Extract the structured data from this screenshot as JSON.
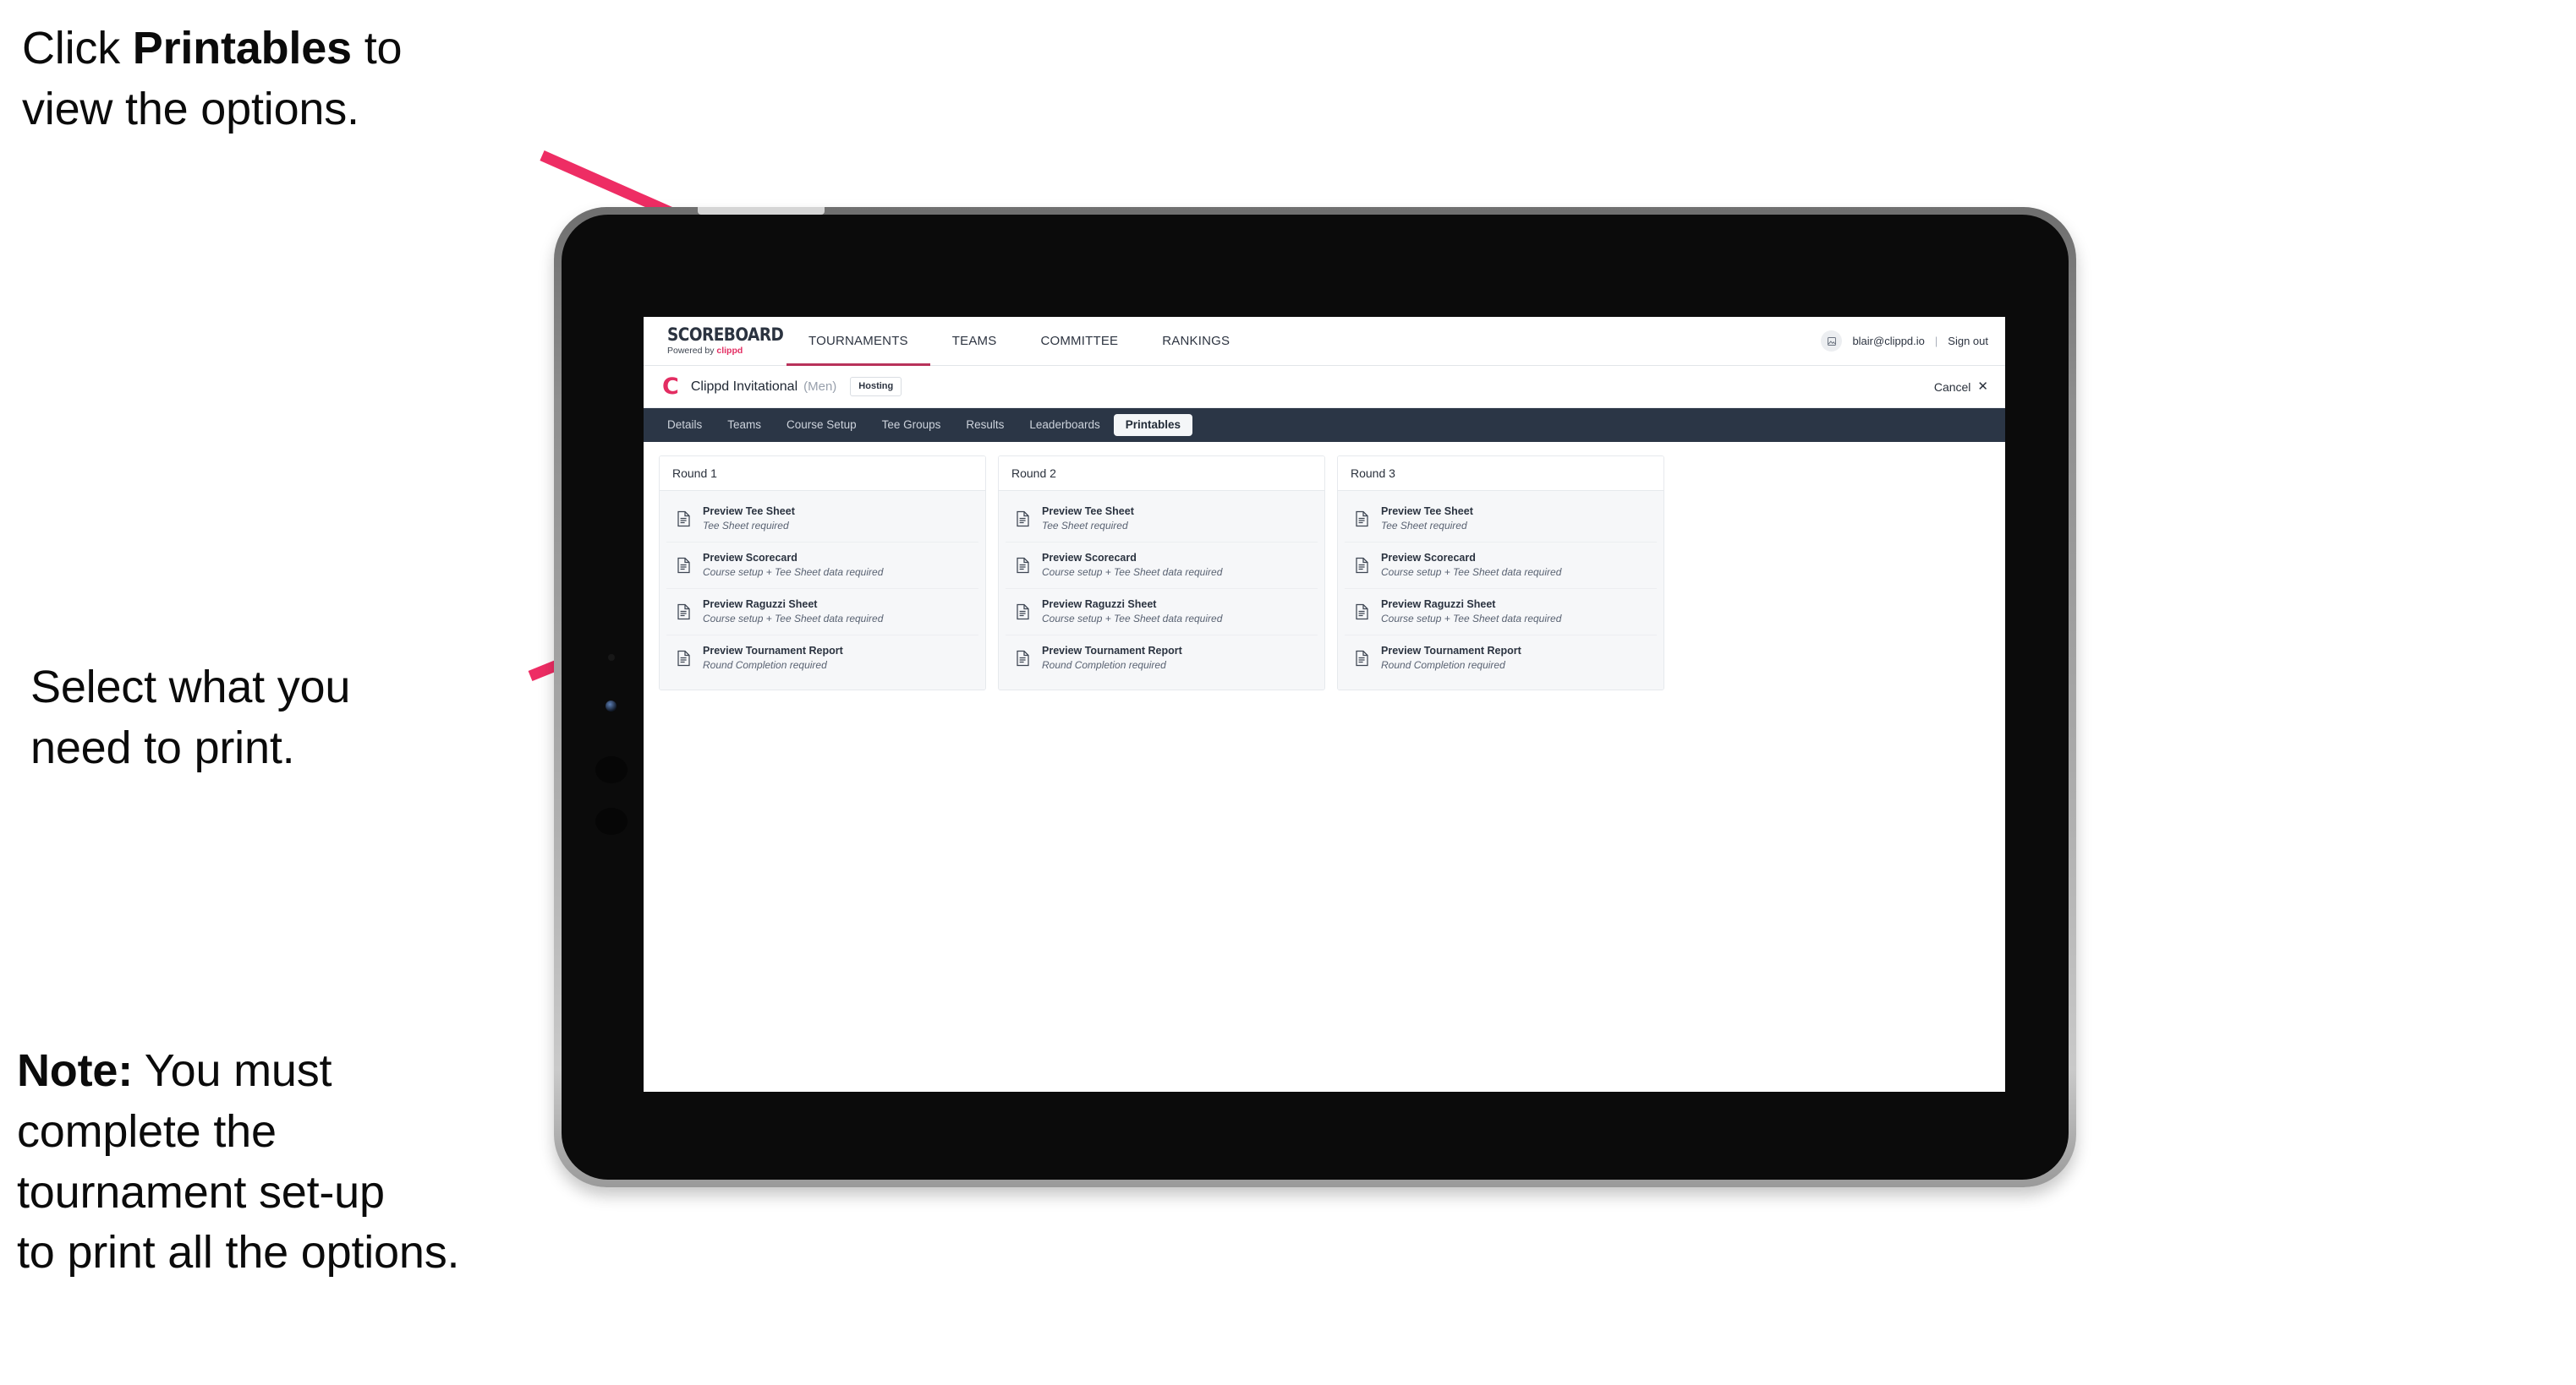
{
  "annotations": {
    "callout_1": {
      "prefix": "Click ",
      "bold": "Printables",
      "suffix": " to\nview the options."
    },
    "callout_2": {
      "text": "Select what you\n need to print."
    },
    "callout_3": {
      "bold": "Note:",
      "text": " You must\ncomplete the\ntournament set-up\nto print all the options."
    },
    "arrow_color": "#ee2d64"
  },
  "app": {
    "brand": {
      "title": "SCOREBOARD",
      "powered_by": "Powered by ",
      "clippd": "clippd"
    },
    "main_nav": [
      {
        "label": "TOURNAMENTS",
        "active": true
      },
      {
        "label": "TEAMS",
        "active": false
      },
      {
        "label": "COMMITTEE",
        "active": false
      },
      {
        "label": "RANKINGS",
        "active": false
      }
    ],
    "account": {
      "avatar_icon": "user-avatar-icon",
      "email": "blair@clippd.io",
      "separator": "|",
      "sign_out": "Sign out"
    },
    "tournament_header": {
      "logo_letter": "C",
      "name": "Clippd Invitational",
      "gender": "(Men)",
      "status_badge": "Hosting",
      "cancel_label": "Cancel",
      "cancel_icon": "close-icon"
    },
    "tabs": [
      {
        "label": "Details",
        "active": false
      },
      {
        "label": "Teams",
        "active": false
      },
      {
        "label": "Course Setup",
        "active": false
      },
      {
        "label": "Tee Groups",
        "active": false
      },
      {
        "label": "Results",
        "active": false
      },
      {
        "label": "Leaderboards",
        "active": false
      },
      {
        "label": "Printables",
        "active": true
      }
    ],
    "rounds": [
      {
        "title": "Round 1",
        "items": [
          {
            "title": "Preview Tee Sheet",
            "subtitle": "Tee Sheet required",
            "icon": "document-icon"
          },
          {
            "title": "Preview Scorecard",
            "subtitle": "Course setup + Tee Sheet data required",
            "icon": "document-icon"
          },
          {
            "title": "Preview Raguzzi Sheet",
            "subtitle": "Course setup + Tee Sheet data required",
            "icon": "document-icon"
          },
          {
            "title": "Preview Tournament Report",
            "subtitle": "Round Completion required",
            "icon": "document-icon"
          }
        ]
      },
      {
        "title": "Round 2",
        "items": [
          {
            "title": "Preview Tee Sheet",
            "subtitle": "Tee Sheet required",
            "icon": "document-icon"
          },
          {
            "title": "Preview Scorecard",
            "subtitle": "Course setup + Tee Sheet data required",
            "icon": "document-icon"
          },
          {
            "title": "Preview Raguzzi Sheet",
            "subtitle": "Course setup + Tee Sheet data required",
            "icon": "document-icon"
          },
          {
            "title": "Preview Tournament Report",
            "subtitle": "Round Completion required",
            "icon": "document-icon"
          }
        ]
      },
      {
        "title": "Round 3",
        "items": [
          {
            "title": "Preview Tee Sheet",
            "subtitle": "Tee Sheet required",
            "icon": "document-icon"
          },
          {
            "title": "Preview Scorecard",
            "subtitle": "Course setup + Tee Sheet data required",
            "icon": "document-icon"
          },
          {
            "title": "Preview Raguzzi Sheet",
            "subtitle": "Course setup + Tee Sheet data required",
            "icon": "document-icon"
          },
          {
            "title": "Preview Tournament Report",
            "subtitle": "Round Completion required",
            "icon": "document-icon"
          }
        ]
      }
    ],
    "colors": {
      "accent": "#e32d62",
      "navbar": "#2b3646",
      "active_underline": "#b8325a"
    }
  }
}
